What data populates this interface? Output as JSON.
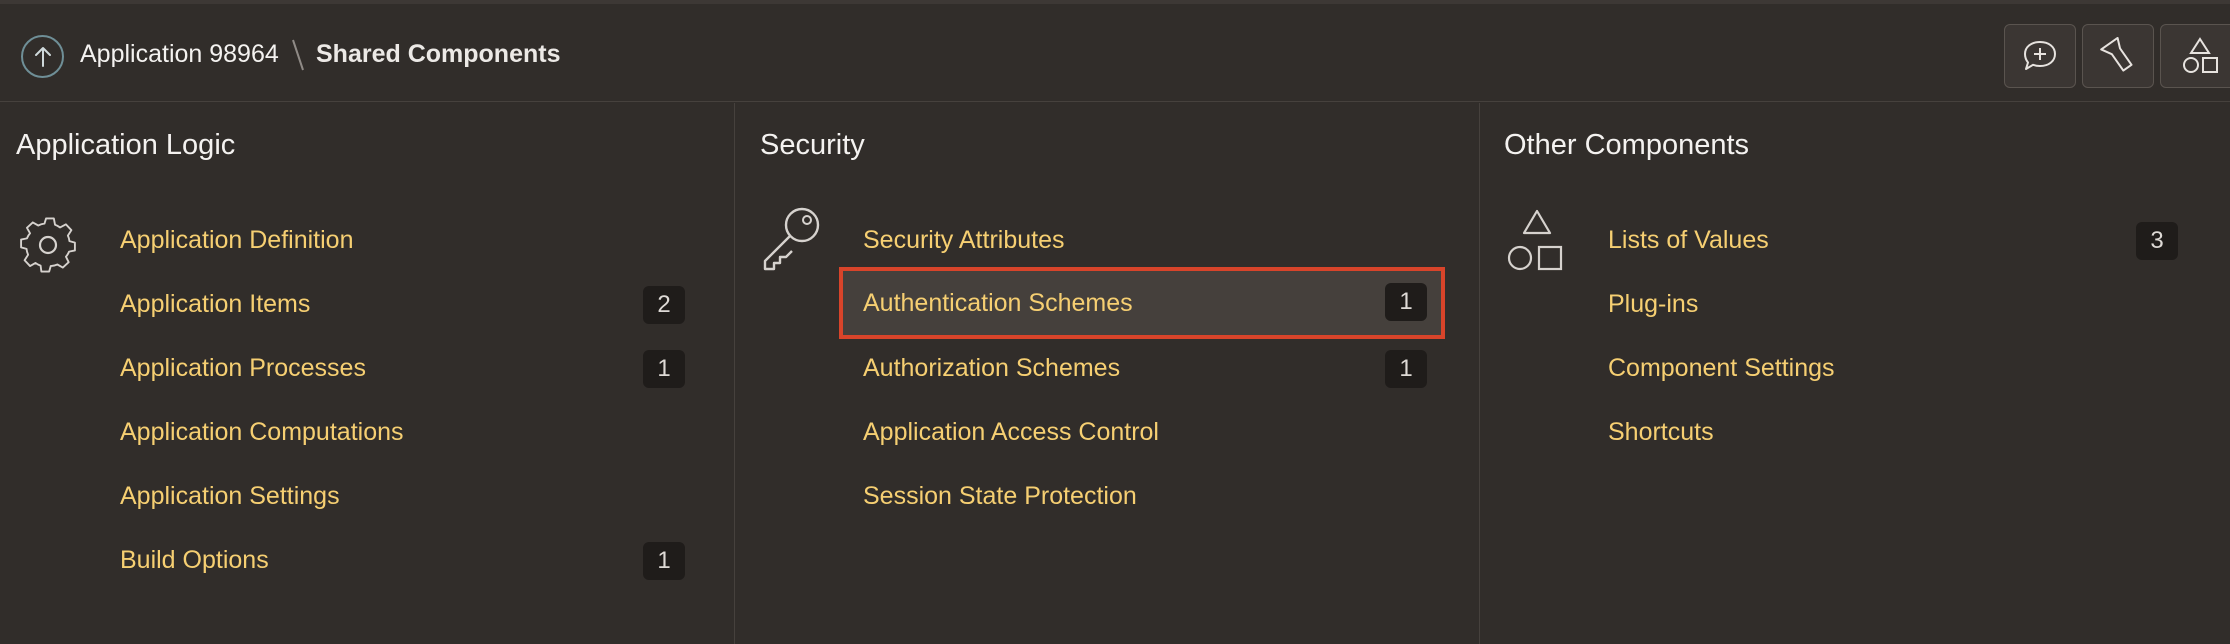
{
  "header": {
    "app_name": "Application 98964",
    "current": "Shared Components"
  },
  "panels": [
    {
      "title": "Application Logic",
      "icon": "gear-icon",
      "items": [
        {
          "label": "Application Definition",
          "badge": ""
        },
        {
          "label": "Application Items",
          "badge": "2"
        },
        {
          "label": "Application Processes",
          "badge": "1"
        },
        {
          "label": "Application Computations",
          "badge": ""
        },
        {
          "label": "Application Settings",
          "badge": ""
        },
        {
          "label": "Build Options",
          "badge": "1"
        }
      ]
    },
    {
      "title": "Security",
      "icon": "key-icon",
      "items": [
        {
          "label": "Security Attributes",
          "badge": ""
        },
        {
          "label": "Authentication Schemes",
          "badge": "1"
        },
        {
          "label": "Authorization Schemes",
          "badge": "1"
        },
        {
          "label": "Application Access Control",
          "badge": ""
        },
        {
          "label": "Session State Protection",
          "badge": ""
        }
      ]
    },
    {
      "title": "Other Components",
      "icon": "shapes-icon",
      "items": [
        {
          "label": "Lists of Values",
          "badge": "3"
        },
        {
          "label": "Plug-ins",
          "badge": ""
        },
        {
          "label": "Component Settings",
          "badge": ""
        },
        {
          "label": "Shortcuts",
          "badge": ""
        }
      ]
    }
  ],
  "colors": {
    "background": "#312d2a",
    "link": "#f6cf72",
    "highlight_border": "#d8442a"
  }
}
